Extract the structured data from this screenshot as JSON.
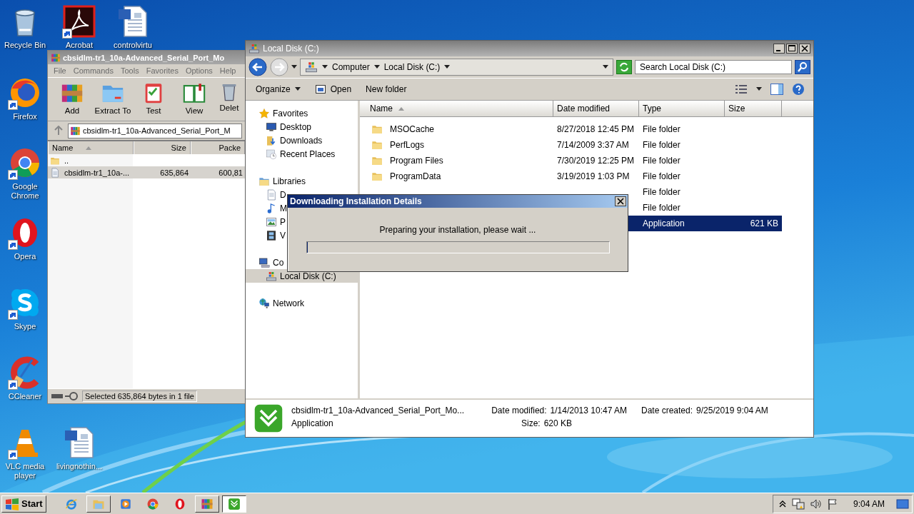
{
  "desktop": {
    "icons": [
      {
        "label": "Recycle Bin",
        "kind": "recycle-bin",
        "shortcut": false
      },
      {
        "label": "Acrobat",
        "kind": "pdf",
        "shortcut": true
      },
      {
        "label": "controlvirtu",
        "kind": "document",
        "shortcut": false
      },
      {
        "label": "Firefox",
        "kind": "firefox",
        "shortcut": true
      },
      {
        "label": "Google Chrome",
        "kind": "chrome",
        "shortcut": true
      },
      {
        "label": "Opera",
        "kind": "opera",
        "shortcut": true
      },
      {
        "label": "Skype",
        "kind": "skype",
        "shortcut": true
      },
      {
        "label": "CCleaner",
        "kind": "ccleaner",
        "shortcut": true
      },
      {
        "label": "VLC media player",
        "kind": "vlc",
        "shortcut": true
      },
      {
        "label": "livingnothin...",
        "kind": "document",
        "shortcut": false
      }
    ]
  },
  "archive_window": {
    "title": "cbsidlm-tr1_10a-Advanced_Serial_Port_Mo",
    "menu": [
      "File",
      "Commands",
      "Tools",
      "Favorites",
      "Options",
      "Help"
    ],
    "toolbar": [
      {
        "label": "Add",
        "kind": "add"
      },
      {
        "label": "Extract To",
        "kind": "extract"
      },
      {
        "label": "Test",
        "kind": "test"
      },
      {
        "label": "View",
        "kind": "view"
      },
      {
        "label": "Delet",
        "kind": "delete"
      }
    ],
    "path": "cbsidlm-tr1_10a-Advanced_Serial_Port_M",
    "columns": [
      "Name",
      "Size",
      "Packe"
    ],
    "rows": [
      {
        "name": "..",
        "kind": "folder",
        "size": "",
        "packed": "",
        "selected": false
      },
      {
        "name": "cbsidlm-tr1_10a-...",
        "kind": "file",
        "size": "635,864",
        "packed": "600,81",
        "selected": true
      }
    ],
    "status": "Selected 635,864 bytes in 1 file"
  },
  "explorer_window": {
    "title": "Local Disk (C:)",
    "breadcrumb": [
      "Computer",
      "Local Disk (C:)"
    ],
    "search": {
      "placeholder": "Search Local Disk (C:)"
    },
    "commands": [
      "Organize",
      "Open",
      "New folder"
    ],
    "nav": [
      {
        "label": "Favorites",
        "kind": "star",
        "selected": false,
        "children": [
          {
            "label": "Desktop",
            "kind": "desktop",
            "selected": false
          },
          {
            "label": "Downloads",
            "kind": "downloads",
            "selected": false
          },
          {
            "label": "Recent Places",
            "kind": "recent",
            "selected": false
          }
        ]
      },
      {
        "label": "Libraries",
        "kind": "library",
        "selected": false,
        "children": [
          {
            "label": "D",
            "kind": "documents",
            "selected": false
          },
          {
            "label": "M",
            "kind": "music",
            "selected": false
          },
          {
            "label": "P",
            "kind": "pictures",
            "selected": false
          },
          {
            "label": "V",
            "kind": "videos",
            "selected": false
          }
        ]
      },
      {
        "label": "Co",
        "kind": "computer",
        "selected": false,
        "children": [
          {
            "label": "Local Disk (C:)",
            "kind": "disk",
            "selected": true
          }
        ]
      },
      {
        "label": "Network",
        "kind": "network",
        "selected": false
      }
    ],
    "columns": [
      "Name",
      "Date modified",
      "Type",
      "Size"
    ],
    "rows": [
      {
        "name": "MSOCache",
        "date": "8/27/2018 12:45 PM",
        "type": "File folder",
        "selected": false
      },
      {
        "name": "PerfLogs",
        "date": "7/14/2009 3:37 AM",
        "type": "File folder",
        "selected": false
      },
      {
        "name": "Program Files",
        "date": "7/30/2019 12:25 PM",
        "type": "File folder",
        "selected": false
      },
      {
        "name": "ProgramData",
        "date": "3/19/2019 1:03 PM",
        "type": "File folder",
        "selected": false
      },
      {
        "type": "File folder",
        "selected": false
      },
      {
        "type": "File folder",
        "selected": false
      },
      {
        "type": "Application",
        "size": "621 KB",
        "selected": true
      }
    ],
    "details": {
      "name": "cbsidlm-tr1_10a-Advanced_Serial_Port_Mo...",
      "type": "Application",
      "modified_label": "Date modified:",
      "modified": "1/14/2013 10:47 AM",
      "size_label": "Size:",
      "size": "620 KB",
      "created_label": "Date created:",
      "created": "9/25/2019 9:04 AM"
    }
  },
  "dialog": {
    "title": "Downloading Installation Details",
    "message": "Preparing your installation, please wait ...",
    "level": 0
  },
  "taskbar": {
    "start": "Start",
    "buttons": [
      {
        "kind": "ie",
        "open": false,
        "selected": false
      },
      {
        "kind": "explorer",
        "open": true,
        "selected": false
      },
      {
        "kind": "media",
        "open": false,
        "selected": false
      },
      {
        "kind": "chrome",
        "open": false,
        "selected": false
      },
      {
        "kind": "opera",
        "open": false,
        "selected": false
      },
      {
        "kind": "winrar",
        "open": true,
        "selected": false
      },
      {
        "kind": "installer",
        "open": true,
        "selected": true
      }
    ],
    "clock": "9:04 AM"
  }
}
